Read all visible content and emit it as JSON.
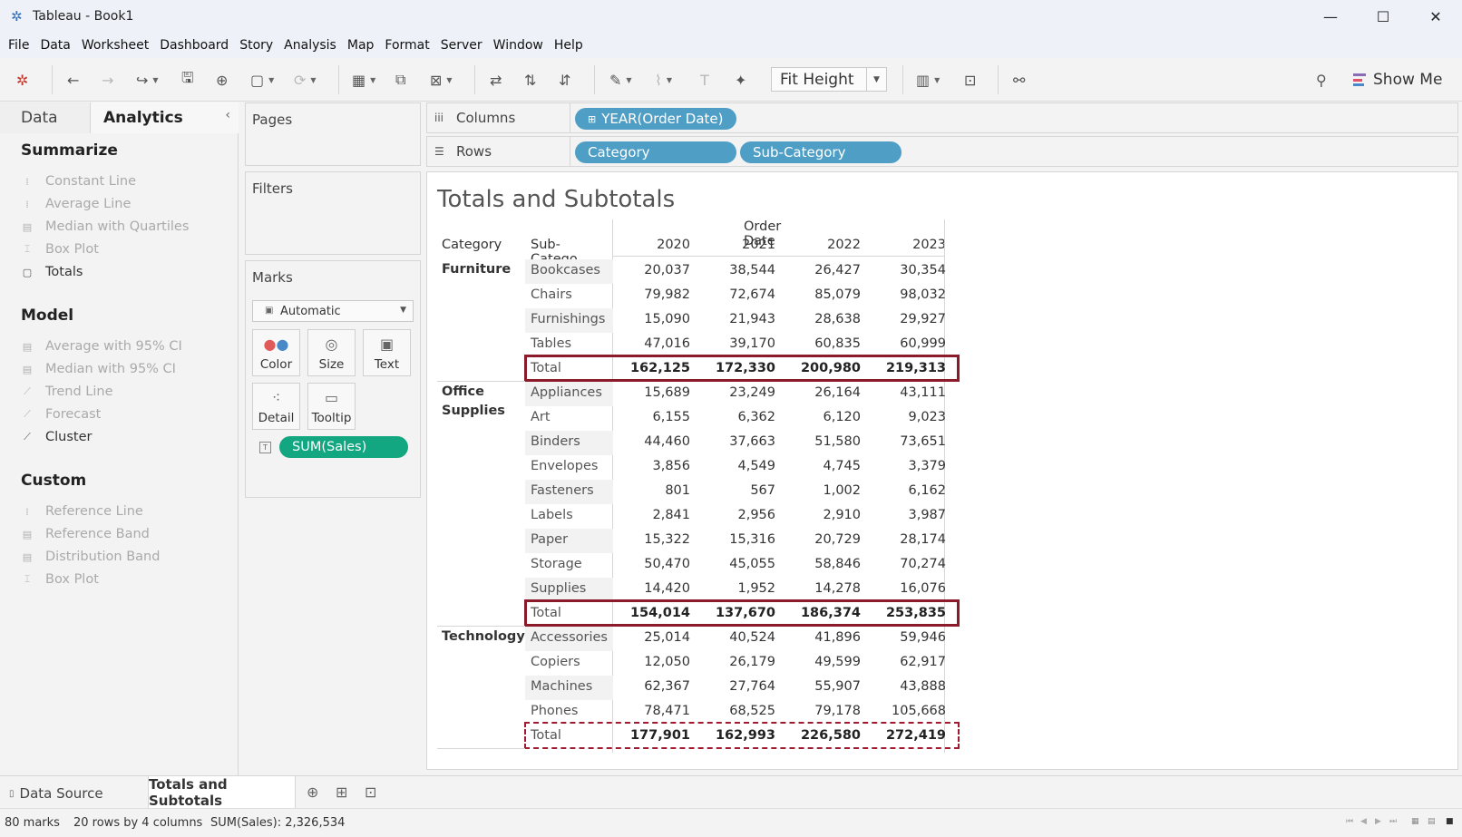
{
  "window": {
    "title": "Tableau - Book1",
    "controls": [
      "—",
      "☐",
      "✕"
    ]
  },
  "menu": [
    "File",
    "Data",
    "Worksheet",
    "Dashboard",
    "Story",
    "Analysis",
    "Map",
    "Format",
    "Server",
    "Window",
    "Help"
  ],
  "toolbar": {
    "fit": "Fit Height",
    "show_me": "Show Me"
  },
  "left_panel": {
    "tabs": {
      "data": "Data",
      "analytics": "Analytics"
    },
    "sections": {
      "summarize": "Summarize",
      "model": "Model",
      "custom": "Custom"
    },
    "summarize_items": [
      "Constant Line",
      "Average Line",
      "Median with Quartiles",
      "Box Plot",
      "Totals"
    ],
    "model_items": [
      "Average with 95% CI",
      "Median with 95% CI",
      "Trend Line",
      "Forecast",
      "Cluster"
    ],
    "custom_items": [
      "Reference Line",
      "Reference Band",
      "Distribution Band",
      "Box Plot"
    ]
  },
  "cards": {
    "pages": "Pages",
    "filters": "Filters",
    "marks": "Marks",
    "marks_type": "Automatic",
    "mark_buttons": [
      "Color",
      "Size",
      "Text",
      "Detail",
      "Tooltip"
    ],
    "measure_pill": "SUM(Sales)"
  },
  "shelves": {
    "columns_label": "Columns",
    "rows_label": "Rows",
    "columns_pill": "YEAR(Order Date)",
    "rows_pills": [
      "Category",
      "Sub-Category"
    ]
  },
  "worksheet": {
    "title": "Totals and Subtotals",
    "header": {
      "order_date": "Order Date",
      "category": "Category",
      "sub_category": "Sub-Catego..",
      "years": [
        "2020",
        "2021",
        "2022",
        "2023"
      ]
    },
    "categories": [
      {
        "name": "Furniture",
        "rows": [
          {
            "sub": "Bookcases",
            "values": [
              "20,037",
              "38,544",
              "26,427",
              "30,354"
            ]
          },
          {
            "sub": "Chairs",
            "values": [
              "79,982",
              "72,674",
              "85,079",
              "98,032"
            ]
          },
          {
            "sub": "Furnishings",
            "values": [
              "15,090",
              "21,943",
              "28,638",
              "29,927"
            ]
          },
          {
            "sub": "Tables",
            "values": [
              "47,016",
              "39,170",
              "60,835",
              "60,999"
            ]
          }
        ],
        "total": {
          "label": "Total",
          "values": [
            "162,125",
            "172,330",
            "200,980",
            "219,313"
          ]
        }
      },
      {
        "name": "Office Supplies",
        "rows": [
          {
            "sub": "Appliances",
            "values": [
              "15,689",
              "23,249",
              "26,164",
              "43,111"
            ]
          },
          {
            "sub": "Art",
            "values": [
              "6,155",
              "6,362",
              "6,120",
              "9,023"
            ]
          },
          {
            "sub": "Binders",
            "values": [
              "44,460",
              "37,663",
              "51,580",
              "73,651"
            ]
          },
          {
            "sub": "Envelopes",
            "values": [
              "3,856",
              "4,549",
              "4,745",
              "3,379"
            ]
          },
          {
            "sub": "Fasteners",
            "values": [
              "801",
              "567",
              "1,002",
              "6,162"
            ]
          },
          {
            "sub": "Labels",
            "values": [
              "2,841",
              "2,956",
              "2,910",
              "3,987"
            ]
          },
          {
            "sub": "Paper",
            "values": [
              "15,322",
              "15,316",
              "20,729",
              "28,174"
            ]
          },
          {
            "sub": "Storage",
            "values": [
              "50,470",
              "45,055",
              "58,846",
              "70,274"
            ]
          },
          {
            "sub": "Supplies",
            "values": [
              "14,420",
              "1,952",
              "14,278",
              "16,076"
            ]
          }
        ],
        "total": {
          "label": "Total",
          "values": [
            "154,014",
            "137,670",
            "186,374",
            "253,835"
          ]
        }
      },
      {
        "name": "Technology",
        "rows": [
          {
            "sub": "Accessories",
            "values": [
              "25,014",
              "40,524",
              "41,896",
              "59,946"
            ]
          },
          {
            "sub": "Copiers",
            "values": [
              "12,050",
              "26,179",
              "49,599",
              "62,917"
            ]
          },
          {
            "sub": "Machines",
            "values": [
              "62,367",
              "27,764",
              "55,907",
              "43,888"
            ]
          },
          {
            "sub": "Phones",
            "values": [
              "78,471",
              "68,525",
              "79,178",
              "105,668"
            ]
          }
        ],
        "total": {
          "label": "Total",
          "values": [
            "177,901",
            "162,993",
            "226,580",
            "272,419"
          ]
        }
      }
    ]
  },
  "sheet_tabs": {
    "data_source": "Data Source",
    "active_sheet": "Totals and Subtotals"
  },
  "status": {
    "marks": "80 marks",
    "dims": "20 rows by 4 columns",
    "sum": "SUM(Sales): 2,326,534"
  },
  "colors": {
    "dimension_pill": "#4f9ec5",
    "measure_pill": "#12a681",
    "total_box": "#8b1a2b"
  }
}
